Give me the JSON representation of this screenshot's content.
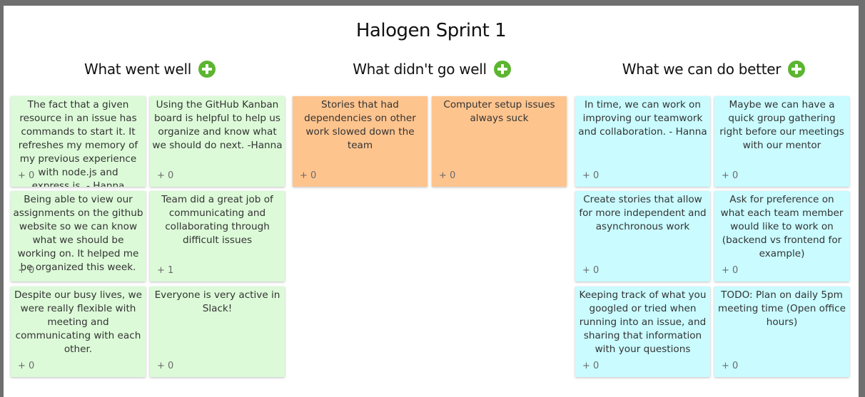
{
  "board": {
    "title": "Halogen Sprint 1"
  },
  "columns": [
    {
      "header": "What went well",
      "color": "#dcfad8",
      "notes": [
        {
          "text": "The fact that a given resource in an issue has commands to start it. It refreshes my memory of my previous experience with node.js and express.js. - Hanna",
          "votes": "+ 0"
        },
        {
          "text": "Using the GitHub Kanban board is helpful to help us organize and know what we should do next. -Hanna",
          "votes": "+ 0"
        },
        {
          "text": "Being able to view our assignments on the github website so we can know what we should be working on. It helped me be organized this week.",
          "votes": "+ 0"
        },
        {
          "text": "Team did a great job of communicating and collaborating through difficult issues",
          "votes": "+ 1"
        },
        {
          "text": "Despite our busy lives, we were really flexible with meeting and communicating with each other.",
          "votes": "+ 0"
        },
        {
          "text": "Everyone is very active in Slack!",
          "votes": "+ 0"
        }
      ]
    },
    {
      "header": "What didn't go well",
      "color": "#fec48e",
      "notes": [
        {
          "text": "Stories that had dependencies on other work slowed down the team",
          "votes": "+ 0"
        },
        {
          "text": "Computer setup issues always suck",
          "votes": "+ 0"
        }
      ]
    },
    {
      "header": "What we can do better",
      "color": "#c9fbff",
      "notes": [
        {
          "text": "In time, we can work on improving our teamwork and collaboration. - Hanna",
          "votes": "+ 0"
        },
        {
          "text": "Maybe we can have a quick group gathering right before our meetings with our mentor",
          "votes": "+ 0"
        },
        {
          "text": "Create stories that allow for more independent and asynchronous work",
          "votes": "+ 0"
        },
        {
          "text": "Ask for preference on what each team member would like to work on (backend vs frontend for example)",
          "votes": "+ 0"
        },
        {
          "text": "Keeping track of what you googled or tried when running into an issue, and sharing that information with your questions",
          "votes": "+ 0"
        },
        {
          "text": "TODO: Plan on daily 5pm meeting time (Open office hours)",
          "votes": "+ 0"
        }
      ]
    }
  ]
}
